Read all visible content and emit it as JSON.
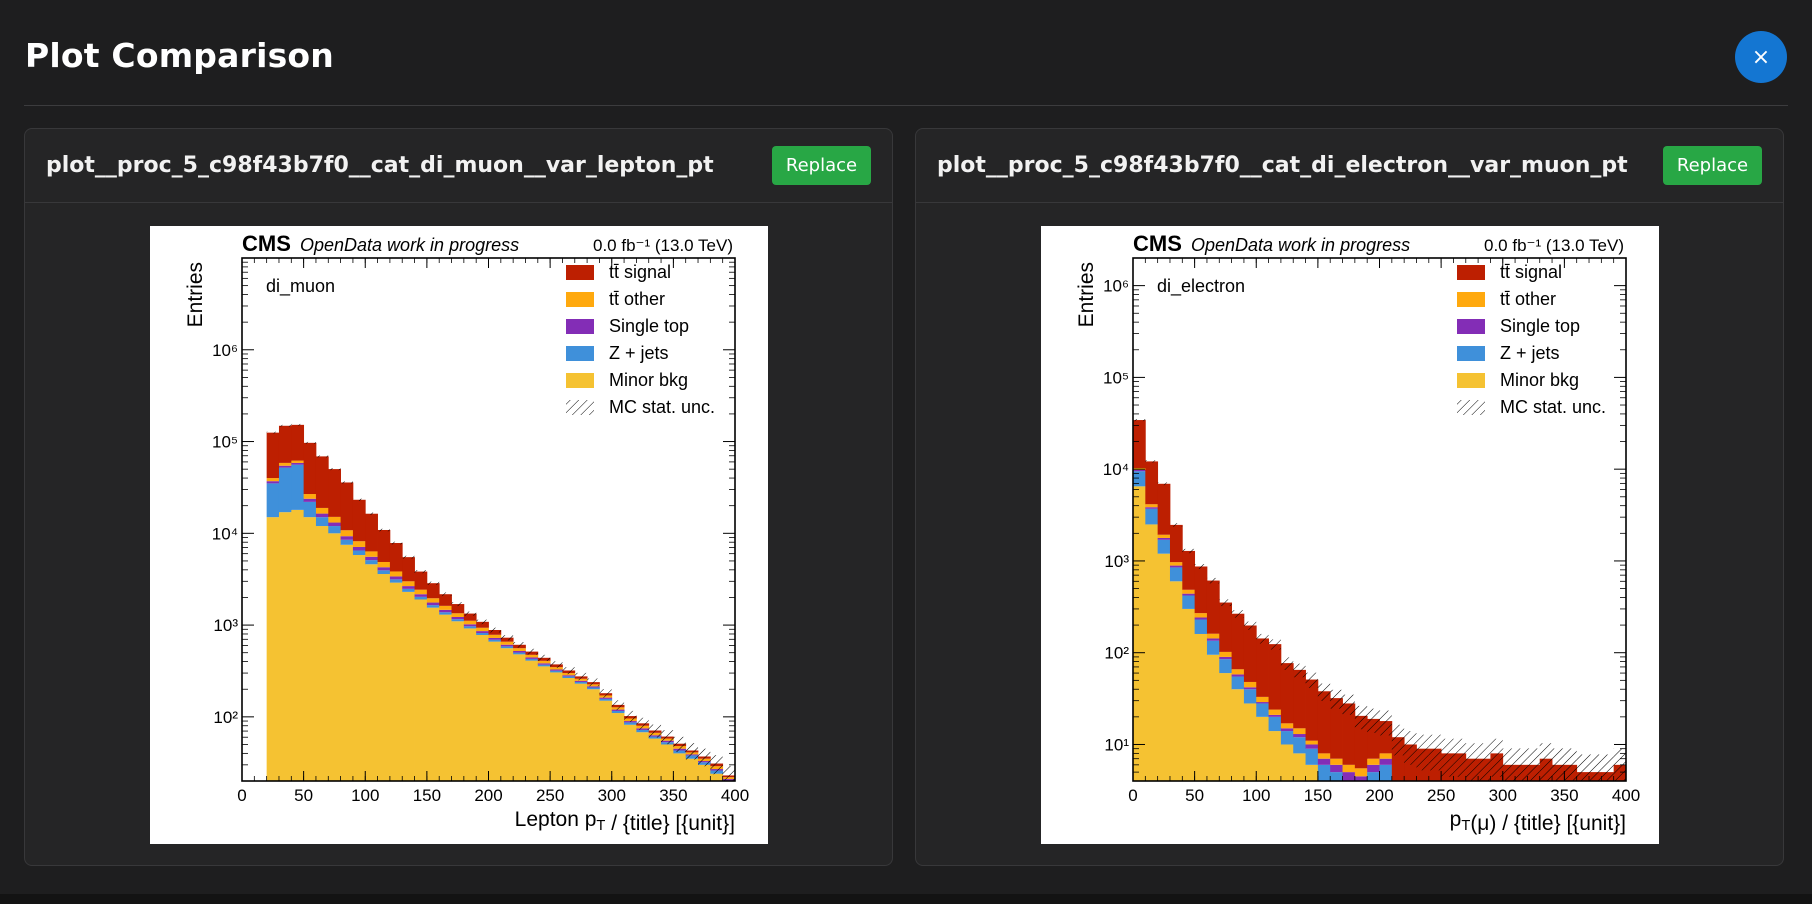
{
  "modal": {
    "title": "Plot Comparison",
    "close_label": "×"
  },
  "panels": [
    {
      "title": "plot__proc_5_c98f43b7f0__cat_di_muon__var_lepton_pt",
      "replace_label": "Replace",
      "chart_data": {
        "type": "bar",
        "stacked": true,
        "log_y": true,
        "experiment_label": "CMS",
        "experiment_sublabel": "OpenData work in progress",
        "lumi_label": "0.0 fb⁻¹ (13.0 TeV)",
        "category_label": "di_muon",
        "ylabel": "Entries",
        "xlabel": "Lepton p_T / {title} [{unit}]",
        "xlim": [
          0,
          400
        ],
        "ylim": [
          20,
          10000000
        ],
        "x_ticks": [
          0,
          50,
          100,
          150,
          200,
          250,
          300,
          350,
          400
        ],
        "y_tick_labels": [
          "10²",
          "10³",
          "10⁴",
          "10⁵",
          "10⁶"
        ],
        "bin_width": 10,
        "bin_edges_start": 20,
        "legend": [
          "tt̄ signal",
          "tt̄ other",
          "Single top",
          "Z + jets",
          "Minor bkg",
          "MC stat. unc."
        ],
        "series": [
          {
            "name": "Minor bkg",
            "color": "#f5c232",
            "values": [
              15000,
              17000,
              18000,
              15000,
              12000,
              10000,
              7500,
              5800,
              4600,
              3600,
              2900,
              2300,
              1900,
              1550,
              1300,
              1100,
              920,
              780,
              660,
              560,
              480,
              410,
              355,
              305,
              265,
              230,
              200,
              150,
              110,
              82,
              68,
              58,
              50,
              40,
              35,
              30,
              24,
              18
            ]
          },
          {
            "name": "Z + jets",
            "color": "#3f90da",
            "values": [
              20000,
              35000,
              38000,
              7000,
              3000,
              2000,
              1000,
              700,
              500,
              350,
              250,
              180,
              130,
              100,
              80,
              60,
              50,
              40,
              32,
              26,
              22,
              18,
              15,
              13,
              11,
              10,
              9,
              7,
              6,
              5,
              4,
              3,
              3,
              3,
              3,
              2,
              2,
              2
            ]
          },
          {
            "name": "Single top",
            "color": "#832db6",
            "values": [
              2000,
              2500,
              2500,
              1800,
              1400,
              1100,
              800,
              600,
              450,
              320,
              240,
              180,
              140,
              110,
              85,
              65,
              50,
              40,
              32,
              25,
              20,
              16,
              13,
              10,
              8,
              7,
              6,
              5,
              4,
              3,
              3,
              2,
              2,
              2,
              1,
              1,
              1,
              1
            ]
          },
          {
            "name": "tt̄ other",
            "color": "#ffa90e",
            "values": [
              3000,
              4000,
              3500,
              3000,
              2500,
              2000,
              1500,
              1100,
              800,
              600,
              450,
              340,
              260,
              200,
              155,
              120,
              95,
              75,
              60,
              48,
              38,
              30,
              25,
              20,
              16,
              13,
              11,
              9,
              7,
              6,
              5,
              4,
              3,
              3,
              2,
              2,
              2,
              1
            ]
          },
          {
            "name": "tt̄ signal",
            "color": "#bd1f01",
            "values": [
              85000,
              90000,
              90000,
              70000,
              50000,
              35000,
              25000,
              15000,
              10000,
              6000,
              4000,
              2500,
              1400,
              900,
              550,
              350,
              220,
              150,
              100,
              70,
              50,
              40,
              32,
              25,
              20,
              16,
              13,
              10,
              8,
              6,
              5,
              4,
              3,
              3,
              2,
              2,
              2,
              1
            ]
          }
        ]
      }
    },
    {
      "title": "plot__proc_5_c98f43b7f0__cat_di_electron__var_muon_pt",
      "replace_label": "Replace",
      "chart_data": {
        "type": "bar",
        "stacked": true,
        "log_y": true,
        "experiment_label": "CMS",
        "experiment_sublabel": "OpenData work in progress",
        "lumi_label": "0.0 fb⁻¹ (13.0 TeV)",
        "category_label": "di_electron",
        "ylabel": "Entries",
        "xlabel": "p_T(μ) / {title} [{unit}]",
        "xlim": [
          0,
          400
        ],
        "ylim": [
          4,
          2000000
        ],
        "x_ticks": [
          0,
          50,
          100,
          150,
          200,
          250,
          300,
          350,
          400
        ],
        "y_tick_labels": [
          "10¹",
          "10²",
          "10³",
          "10⁴",
          "10⁵",
          "10⁶"
        ],
        "bin_width": 10,
        "bin_edges_start": 0,
        "legend": [
          "tt̄ signal",
          "tt̄ other",
          "Single top",
          "Z + jets",
          "Minor bkg",
          "MC stat. unc."
        ],
        "series": [
          {
            "name": "Minor bkg",
            "color": "#f5c232",
            "values": [
              6500,
              2500,
              1200,
              600,
              300,
              160,
              95,
              60,
              40,
              28,
              20,
              14,
              10,
              8,
              6,
              4,
              3,
              2,
              1.5,
              1,
              4,
              1,
              1,
              1,
              1,
              1,
              1,
              1,
              1,
              1,
              1,
              1,
              1,
              1,
              1,
              1,
              1,
              1,
              1,
              1
            ]
          },
          {
            "name": "Z + jets",
            "color": "#3f90da",
            "values": [
              3000,
              1200,
              500,
              250,
              120,
              70,
              40,
              25,
              15,
              12,
              8,
              6,
              4,
              4,
              3,
              2,
              2,
              2,
              2,
              4,
              2,
              1,
              1,
              1,
              1,
              1,
              1,
              1,
              1,
              1,
              1,
              1,
              1,
              1,
              1,
              1,
              1,
              1,
              1,
              1
            ]
          },
          {
            "name": "Single top",
            "color": "#832db6",
            "values": [
              300,
              150,
              80,
              40,
              20,
              12,
              8,
              5,
              3,
              2,
              1,
              1,
              1,
              1,
              1,
              1,
              1,
              1,
              1,
              1,
              1,
              1,
              1,
              1,
              1,
              1,
              1,
              1,
              1,
              1,
              1,
              1,
              1,
              1,
              1,
              1,
              1,
              1,
              1,
              1
            ]
          },
          {
            "name": "tt̄ other",
            "color": "#ffa90e",
            "values": [
              500,
              300,
              150,
              80,
              45,
              28,
              18,
              12,
              8,
              6,
              4,
              3,
              2,
              2,
              1,
              1,
              1,
              1,
              1,
              1,
              1,
              1,
              1,
              1,
              1,
              1,
              1,
              1,
              1,
              1,
              1,
              1,
              1,
              1,
              1,
              1,
              1,
              1,
              1,
              1
            ]
          },
          {
            "name": "tt̄ signal",
            "color": "#bd1f01",
            "values": [
              24000,
              8000,
              5000,
              1500,
              800,
              600,
              450,
              250,
              200,
              150,
              110,
              100,
              60,
              50,
              40,
              30,
              25,
              22,
              15,
              12,
              10,
              8,
              6,
              5,
              5,
              4,
              4,
              3,
              3,
              4,
              2,
              2,
              2,
              3,
              2,
              2,
              1,
              1,
              1,
              2
            ]
          }
        ]
      }
    }
  ]
}
